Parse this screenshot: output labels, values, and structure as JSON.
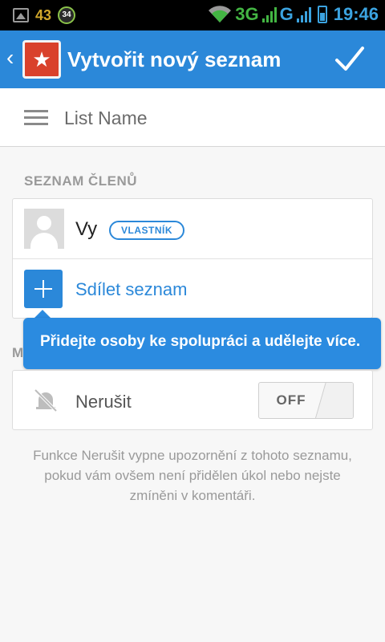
{
  "status_bar": {
    "notification_count": "43",
    "badge_value": "34",
    "network_3g": "3G",
    "network_g": "G",
    "time": "19:46"
  },
  "app_bar": {
    "title": "Vytvořit nový seznam",
    "back_glyph": "‹",
    "logo_glyph": "★",
    "confirm_icon": "checkmark-icon"
  },
  "list_name": {
    "placeholder": "List Name",
    "value": ""
  },
  "members_section": {
    "header": "SEZNAM ČLENŮ",
    "members": [
      {
        "name": "Vy",
        "role_badge": "VLASTNÍK"
      }
    ],
    "share_label": "Sdílet seznam"
  },
  "tooltip": {
    "text": "Přidejte osoby ke spolupráci a udělejte více."
  },
  "mute_section": {
    "header_peek": "M",
    "label": "Nerušit",
    "toggle_state": "OFF",
    "description": "Funkce Nerušit vypne upozornění z tohoto seznamu, pokud vám ovšem není přidělen úkol nebo nejste zmíněni v komentáři."
  },
  "colors": {
    "accent": "#2b88d9",
    "logo_red": "#d9412b",
    "background": "#f7f7f7"
  }
}
